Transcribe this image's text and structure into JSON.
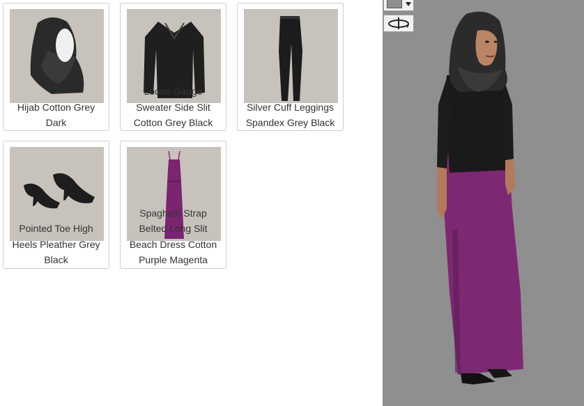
{
  "outfit": {
    "items": [
      {
        "line1": "",
        "line2": "Hijab Cotton Grey",
        "line3": "Dark",
        "icon": "hijab-icon"
      },
      {
        "line1": "Loose Gauge",
        "line2": "Sweater Side Slit",
        "line3": "Cotton Grey Black",
        "icon": "sweater-icon"
      },
      {
        "line1": "",
        "line2": "Silver Cuff Leggings",
        "line3": "Spandex Grey Black",
        "icon": "leggings-icon"
      },
      {
        "line1": "Pointed Toe High",
        "line2": "Heels Pleather Grey",
        "line3": "Black",
        "icon": "heels-icon"
      },
      {
        "line0": "Spaghetti Strap",
        "line1": "Belted Long Slit",
        "line2": "Beach Dress Cotton",
        "line3": "Purple Magenta",
        "icon": "dress-icon"
      }
    ]
  },
  "viewer": {
    "background_color": "#8f8f8f",
    "color_swatch": "#8f8f8f",
    "dropdown_icon": "triangle-down-icon",
    "rotate_icon": "rotate-icon"
  }
}
